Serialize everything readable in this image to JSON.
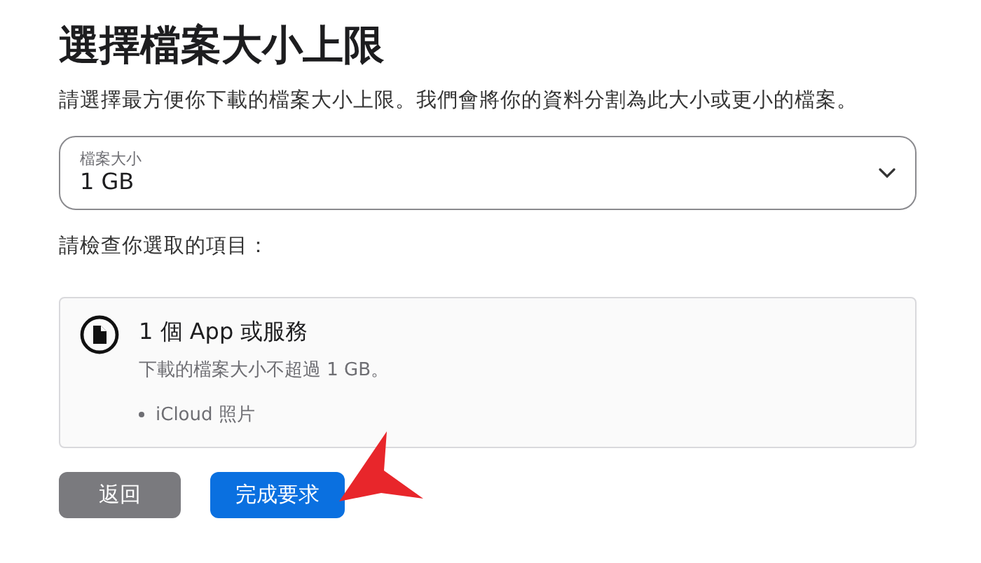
{
  "title": "選擇檔案大小上限",
  "description": "請選擇最方便你下載的檔案大小上限。我們會將你的資料分割為此大小或更小的檔案。",
  "size_select": {
    "label": "檔案大小",
    "value": "1 GB"
  },
  "review_heading": "請檢查你選取的項目：",
  "summary": {
    "title": "1 個 App 或服務",
    "note": "下載的檔案大小不超過 1 GB。",
    "items": [
      "iCloud 照片"
    ]
  },
  "buttons": [
    {
      "label": "返回",
      "kind": "secondary"
    },
    {
      "label": "完成要求",
      "kind": "primary"
    }
  ]
}
